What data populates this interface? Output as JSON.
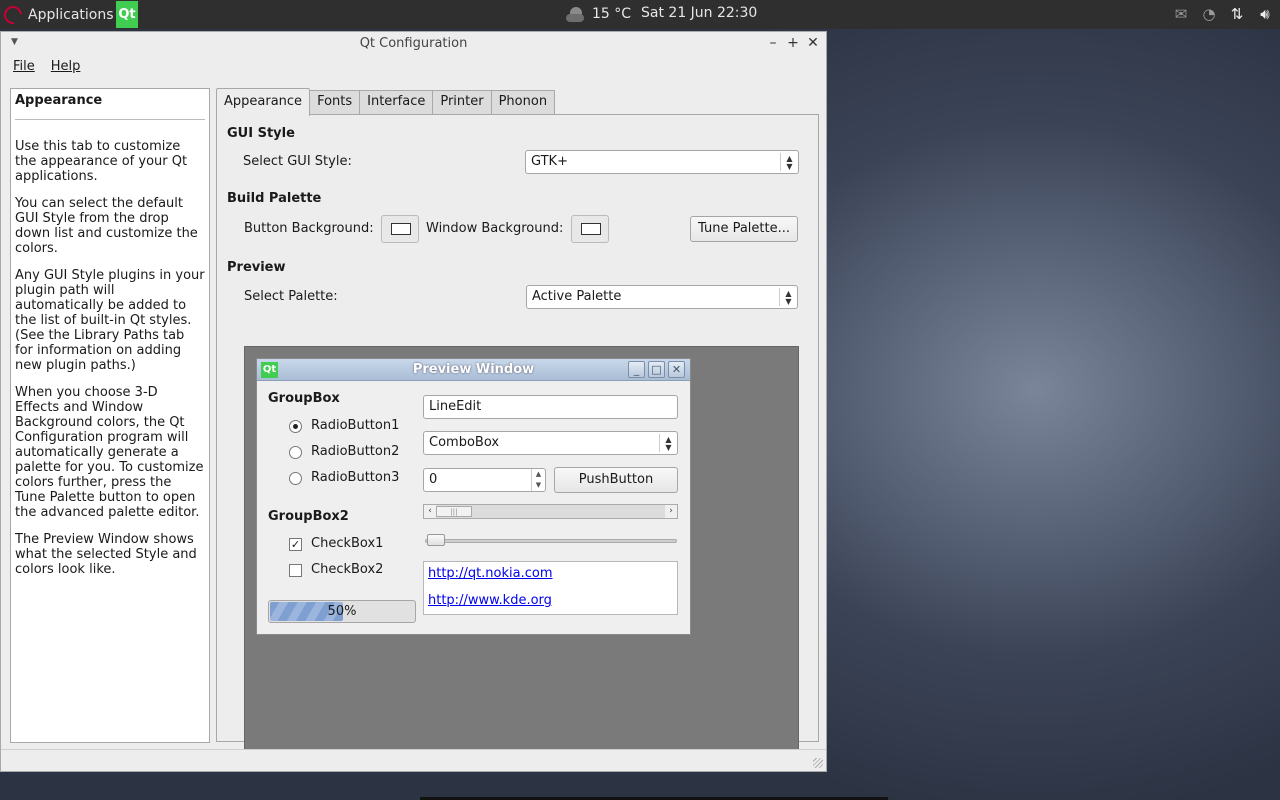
{
  "top_panel": {
    "applications_label": "Applications",
    "qt_launcher_label": "Qt",
    "weather_text": "15 °C",
    "clock_text": "Sat 21 Jun 22:30",
    "tray_icons": [
      "mail-icon",
      "rss-icon",
      "network-transfer-icon",
      "volume-icon"
    ]
  },
  "window": {
    "title": "Qt Configuration",
    "menu": {
      "file": "File",
      "help": "Help"
    }
  },
  "help": {
    "title": "Appearance",
    "paragraphs": [
      "Use this tab to customize the appearance of your Qt applications.",
      "You can select the default GUI Style from the drop down list and customize the colors.",
      "Any GUI Style plugins in your plugin path will automatically be added to the list of built-in Qt styles. (See the Library Paths tab for information on adding new plugin paths.)",
      "When you choose 3-D Effects and Window Background colors, the Qt Configuration program will automatically generate a palette for you. To customize colors further, press the Tune Palette button to open the advanced palette editor.",
      "The Preview Window shows what the selected Style and colors look like."
    ]
  },
  "tabs": [
    "Appearance",
    "Fonts",
    "Interface",
    "Printer",
    "Phonon"
  ],
  "appearance": {
    "gui_style_section": "GUI Style",
    "select_gui_style_label": "Select GUI Style:",
    "gui_style_value": "GTK+",
    "build_palette_section": "Build Palette",
    "button_background_label": "Button Background:",
    "window_background_label": "Window Background:",
    "tune_palette_label": "Tune Palette...",
    "preview_section": "Preview",
    "select_palette_label": "Select Palette:",
    "palette_value": "Active Palette"
  },
  "preview": {
    "title": "Preview Window",
    "groupbox": "GroupBox",
    "radios": [
      "RadioButton1",
      "RadioButton2",
      "RadioButton3"
    ],
    "groupbox2": "GroupBox2",
    "checkboxes": [
      {
        "label": "CheckBox1",
        "checked": true
      },
      {
        "label": "CheckBox2",
        "checked": false
      }
    ],
    "progress_percent": 50,
    "progress_text": "50%",
    "line_edit_value": "LineEdit",
    "combo_value": "ComboBox",
    "spin_value": "0",
    "push_button_label": "PushButton",
    "links": [
      "http://qt.nokia.com",
      "http://www.kde.org"
    ]
  },
  "colors": {
    "qt_green": "#41cd52",
    "link_blue": "#0000ee",
    "preview_bg": "#7a7a7a"
  }
}
